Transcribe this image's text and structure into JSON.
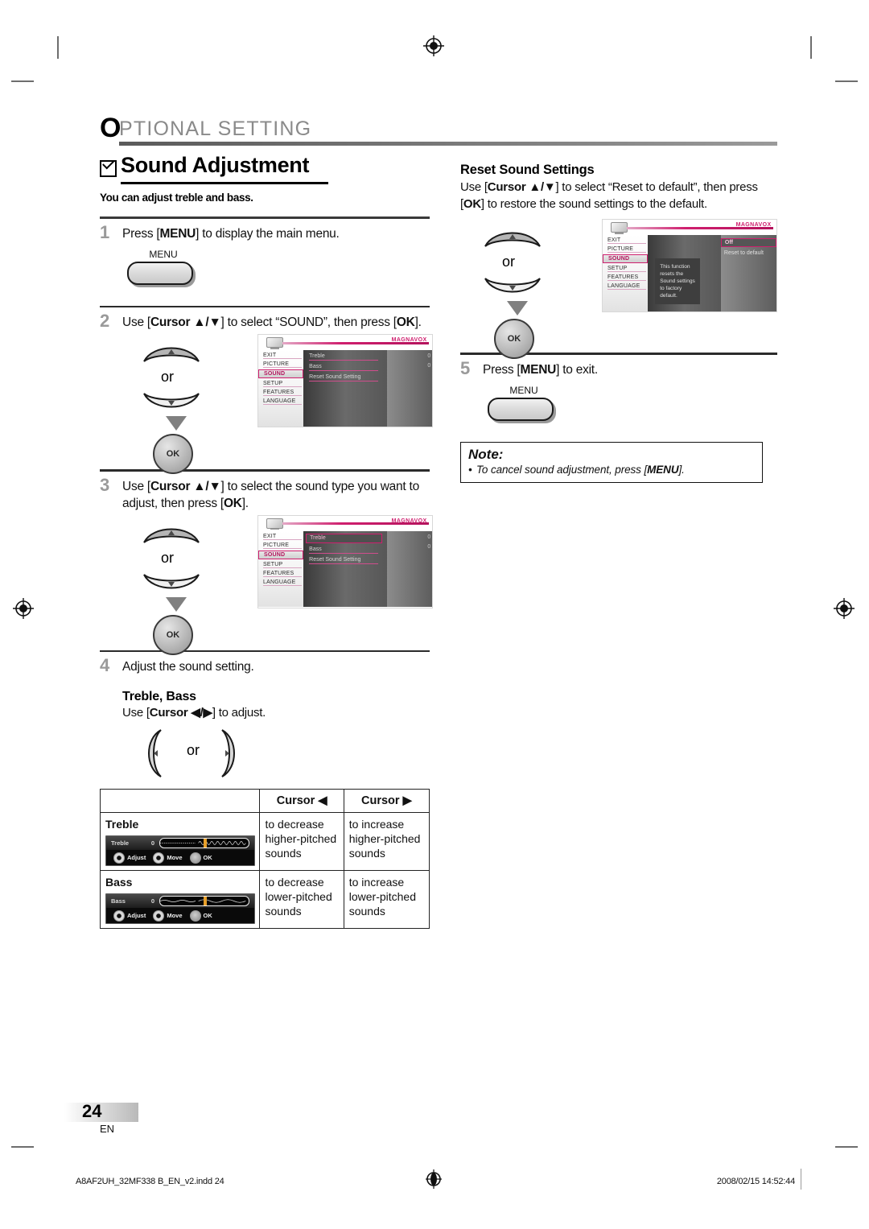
{
  "header": {
    "chapter_initial": "O",
    "chapter_title": "PTIONAL  SETTING"
  },
  "section": {
    "title": "Sound Adjustment",
    "subtitle": "You can adjust treble and bass."
  },
  "steps": [
    {
      "num": "1",
      "text_html": "Press [<b>MENU</b>] to display the main menu.",
      "key_label": "MENU"
    },
    {
      "num": "2",
      "text_html": "Use [<b>Cursor ▲/▼</b>] to select “SOUND”, then press [<b>OK</b>]."
    },
    {
      "num": "3",
      "text_html": "Use [<b>Cursor ▲/▼</b>] to select the sound type you want to adjust, then press [<b>OK</b>]."
    },
    {
      "num": "4",
      "text_html": "Adjust the sound setting."
    },
    {
      "num": "5",
      "text_html": "Press [<b>MENU</b>] to exit.",
      "key_label": "MENU"
    }
  ],
  "cursor_cluster": {
    "up_glyph": "▲",
    "down_glyph": "▼",
    "or_label": "or",
    "ok_label": "OK"
  },
  "lr_cluster": {
    "left_glyph": "◀",
    "right_glyph": "▶",
    "or_label": "or"
  },
  "treble_bass": {
    "heading": "Treble, Bass",
    "instruction_html": "Use [<b>Cursor ◀/▶</b>] to adjust."
  },
  "osd_sound_menu": {
    "brand": "MAGNAVOX",
    "nav_items": [
      "EXIT",
      "PICTURE",
      "SOUND",
      "SETUP",
      "FEATURES",
      "LANGUAGE"
    ],
    "nav_selected": "SOUND",
    "main_items": [
      "Treble",
      "Bass",
      "Reset Sound Setting"
    ],
    "main_values": [
      "0",
      "0"
    ],
    "main_selected_step2": "",
    "main_selected_step3": "Treble"
  },
  "osd_reset_menu": {
    "brand": "MAGNAVOX",
    "nav_items": [
      "EXIT",
      "PICTURE",
      "SOUND",
      "SETUP",
      "FEATURES",
      "LANGUAGE"
    ],
    "nav_selected": "SOUND",
    "info_text": "This function resets the Sound settings to factory default.",
    "options": [
      "Off",
      "Reset to default"
    ],
    "option_selected": "Off"
  },
  "reset_section": {
    "heading": "Reset Sound Settings",
    "body_html": "Use [<b>Cursor ▲/▼</b>] to select “Reset to default”, then press [<b>OK</b>] to restore the sound settings to the default."
  },
  "note": {
    "title": "Note:",
    "bullet_html": "To cancel sound adjustment, press [<b>MENU</b>]."
  },
  "control_table": {
    "headers": [
      "",
      "Cursor ◀",
      "Cursor ▶"
    ],
    "rows": [
      {
        "label": "Treble",
        "osd": {
          "name": "Treble",
          "value": "0"
        },
        "decrease": "to decrease higher-pitched sounds",
        "increase": "to increase higher-pitched sounds"
      },
      {
        "label": "Bass",
        "osd": {
          "name": "Bass",
          "value": "0"
        },
        "decrease": "to decrease lower-pitched sounds",
        "increase": "to increase lower-pitched sounds"
      }
    ],
    "osd_buttons": [
      "Adjust",
      "Move",
      "OK"
    ]
  },
  "footer": {
    "page_number": "24",
    "language_code": "EN",
    "file_name": "A8AF2UH_32MF338 B_EN_v2.indd   24",
    "timestamp": "2008/02/15   14:52:44"
  },
  "colors": {
    "brand_magenta": "#cf1f6e",
    "rule_gray": "#7f7f7f",
    "step_num_gray": "#9a9a9a"
  }
}
